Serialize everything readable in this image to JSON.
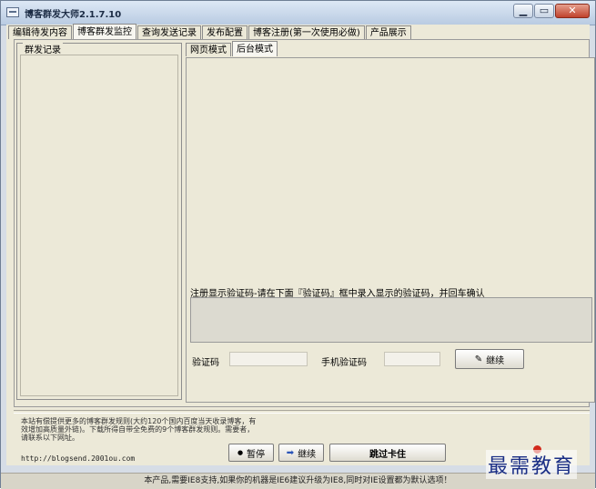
{
  "window": {
    "title": "博客群发大师2.1.7.10",
    "buttons": {
      "minimize": "▁",
      "restore": "▭",
      "close": "✕"
    }
  },
  "tabs": [
    {
      "label": "编辑待发内容",
      "active": false
    },
    {
      "label": "博客群发监控",
      "active": true
    },
    {
      "label": "查询发送记录",
      "active": false
    },
    {
      "label": "发布配置",
      "active": false
    },
    {
      "label": "博客注册(第一次使用必做)",
      "active": false
    },
    {
      "label": "产品展示",
      "active": false
    }
  ],
  "left_group": {
    "legend": "群发记录"
  },
  "subtabs": [
    {
      "label": "网页模式",
      "active": false
    },
    {
      "label": "后台模式",
      "active": true
    }
  ],
  "captcha": {
    "legend": "注册显示验证码-请在下面『验证码』框中录入显示的验证码，并回车确认",
    "code_label": "验证码",
    "code_value": "",
    "phone_label": "手机验证码",
    "phone_value": "",
    "continue_label": "继续"
  },
  "controls": {
    "pause_label": "暂停",
    "continue_label": "继续",
    "skip_label": "跳过卡住"
  },
  "notice": "本站有偿提供更多的博客群发规则(大约120个国内百度当天收录博客，有效增加高质量外链)。下载所得自带全免费的9个博客群发规则。需要者，请联系以下网址。",
  "url": "http://blogsend.2001ou.com",
  "status": "本产品,需要IE8支持,如果你的机器是IE6建议升级为IE8,同时对IE设置都为默认选项！",
  "watermark": "最需教育",
  "colors": {
    "window_bg": "#ece9d8",
    "title_bar": "#c9d7ea",
    "watermark": "#1a2e85"
  }
}
